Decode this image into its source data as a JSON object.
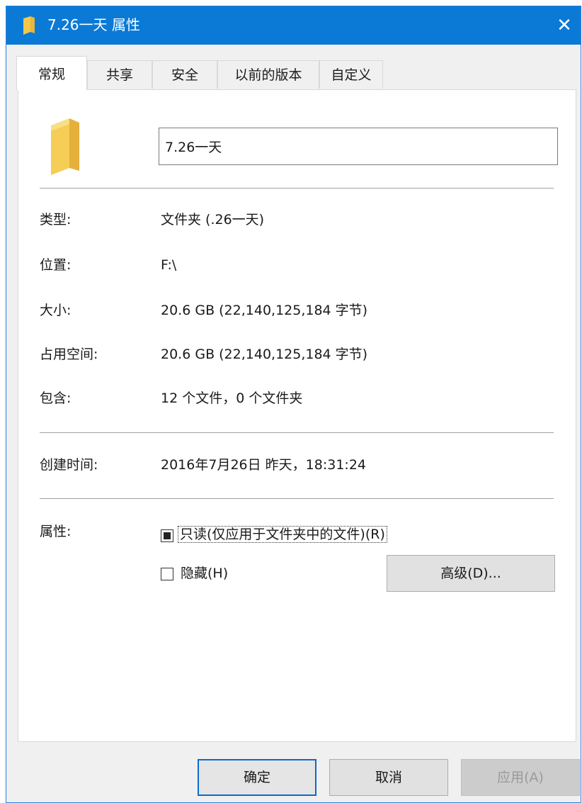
{
  "window": {
    "title": "7.26一天 属性",
    "close_glyph": "✕",
    "accent_color": "#0b7ad6"
  },
  "tabs": [
    {
      "label": "常规",
      "active": true
    },
    {
      "label": "共享",
      "active": false
    },
    {
      "label": "安全",
      "active": false
    },
    {
      "label": "以前的版本",
      "active": false
    },
    {
      "label": "自定义",
      "active": false
    }
  ],
  "general": {
    "name_value": "7.26一天",
    "icon": "folder-icon",
    "type_label": "类型:",
    "type_value": "文件夹 (.26一天)",
    "location_label": "位置:",
    "location_value": "F:\\",
    "size_label": "大小:",
    "size_value": "20.6 GB (22,140,125,184 字节)",
    "size_on_disk_label": "占用空间:",
    "size_on_disk_value": "20.6 GB (22,140,125,184 字节)",
    "contains_label": "包含:",
    "contains_value": "12 个文件，0 个文件夹",
    "created_label": "创建时间:",
    "created_value": "2016年7月26日 昨天，18:31:24",
    "attributes_label": "属性:",
    "readonly_label": "只读(仅应用于文件夹中的文件)(R)",
    "readonly_state": "indeterminate",
    "hidden_label": "隐藏(H)",
    "hidden_state": "unchecked",
    "advanced_button": "高级(D)..."
  },
  "footer": {
    "ok": "确定",
    "cancel": "取消",
    "apply": "应用(A)"
  }
}
